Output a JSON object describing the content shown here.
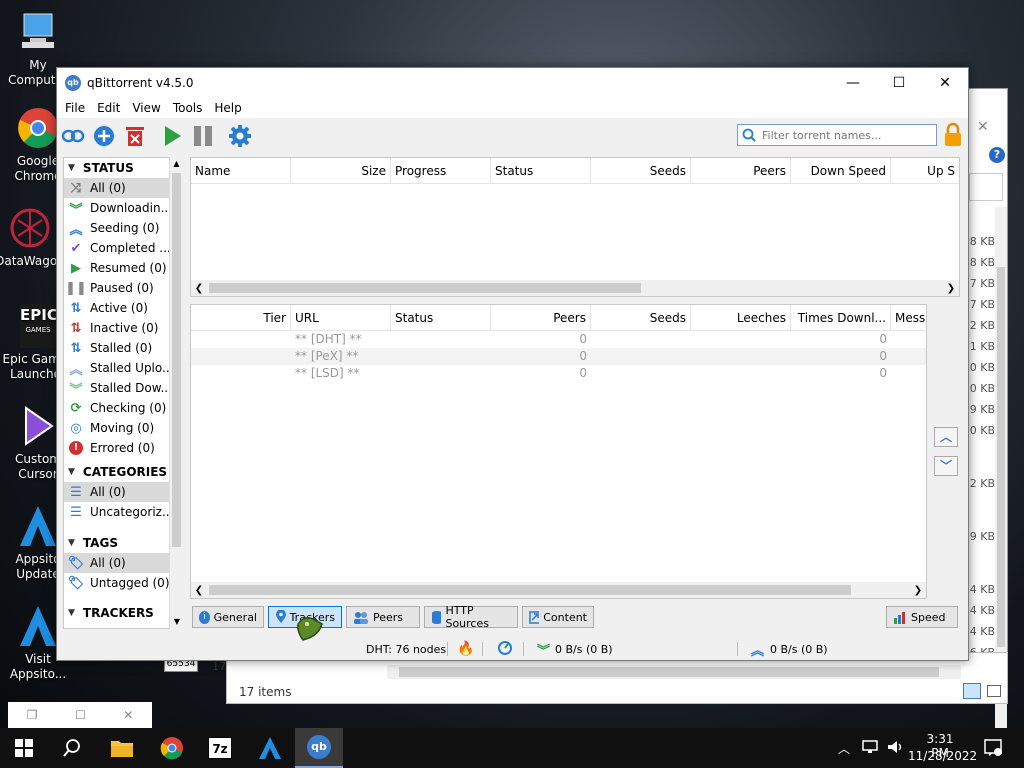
{
  "desktop": {
    "icons": [
      {
        "label": "My Computer"
      },
      {
        "label": "Google Chrome"
      },
      {
        "label": "DataWagon"
      },
      {
        "label": "Epic Games Launcher"
      },
      {
        "label": "Custom Cursor"
      },
      {
        "label": "Appsito Update"
      },
      {
        "label": "Visit Appsito..."
      }
    ],
    "epic_logo_text": "EPIC",
    "epic_logo_sub": "GAMES"
  },
  "background_window": {
    "items_count": "17 items",
    "sizes": [
      "8 KB",
      "8 KB",
      "7 KB",
      "7 KB",
      "2 KB",
      "1 KB",
      "0 KB",
      "0 KB",
      "9 KB",
      "0 KB",
      "2 KB",
      "9 KB",
      "4 KB",
      "4 KB",
      "4 KB",
      "6 KB"
    ],
    "left_number": "65534",
    "left_number2": "17"
  },
  "window": {
    "title": "qBittorrent v4.5.0",
    "minimize": "—",
    "maximize": "☐",
    "close": "✕",
    "menu": [
      "File",
      "Edit",
      "View",
      "Tools",
      "Help"
    ],
    "filter_placeholder": "Filter torrent names...",
    "sidebar": {
      "status_header": "STATUS",
      "status_items": [
        "All (0)",
        "Downloadin...",
        "Seeding (0)",
        "Completed ...",
        "Resumed (0)",
        "Paused (0)",
        "Active (0)",
        "Inactive (0)",
        "Stalled (0)",
        "Stalled Uplo...",
        "Stalled Dow...",
        "Checking (0)",
        "Moving (0)",
        "Errored (0)"
      ],
      "categories_header": "CATEGORIES",
      "categories_items": [
        "All (0)",
        "Uncategoriz..."
      ],
      "tags_header": "TAGS",
      "tags_items": [
        "All (0)",
        "Untagged (0)"
      ],
      "trackers_header": "TRACKERS"
    },
    "torrent_columns": [
      "Name",
      "Size",
      "Progress",
      "Status",
      "Seeds",
      "Peers",
      "Down Speed",
      "Up S"
    ],
    "tracker_columns": [
      "Tier",
      "URL",
      "Status",
      "Peers",
      "Seeds",
      "Leeches",
      "Times Downl...",
      "Messa"
    ],
    "tracker_rows": [
      {
        "url": "** [DHT] **",
        "peers": "0",
        "times": "0"
      },
      {
        "url": "** [PeX] **",
        "peers": "0",
        "times": "0"
      },
      {
        "url": "** [LSD] **",
        "peers": "0",
        "times": "0"
      }
    ],
    "tabs": [
      "General",
      "Trackers",
      "Peers",
      "HTTP Sources",
      "Content"
    ],
    "speed_button": "Speed",
    "status": {
      "dht": "DHT: 76 nodes",
      "down": "0 B/s (0 B)",
      "up": "0 B/s (0 B)"
    }
  },
  "taskbar": {
    "time": "3:31 PM",
    "date": "11/28/2022",
    "zip_label": "7z",
    "qb_label": "qb"
  },
  "colors": {
    "accent": "#3d7cc9",
    "green": "#2ea043",
    "red": "#d32f2f"
  }
}
